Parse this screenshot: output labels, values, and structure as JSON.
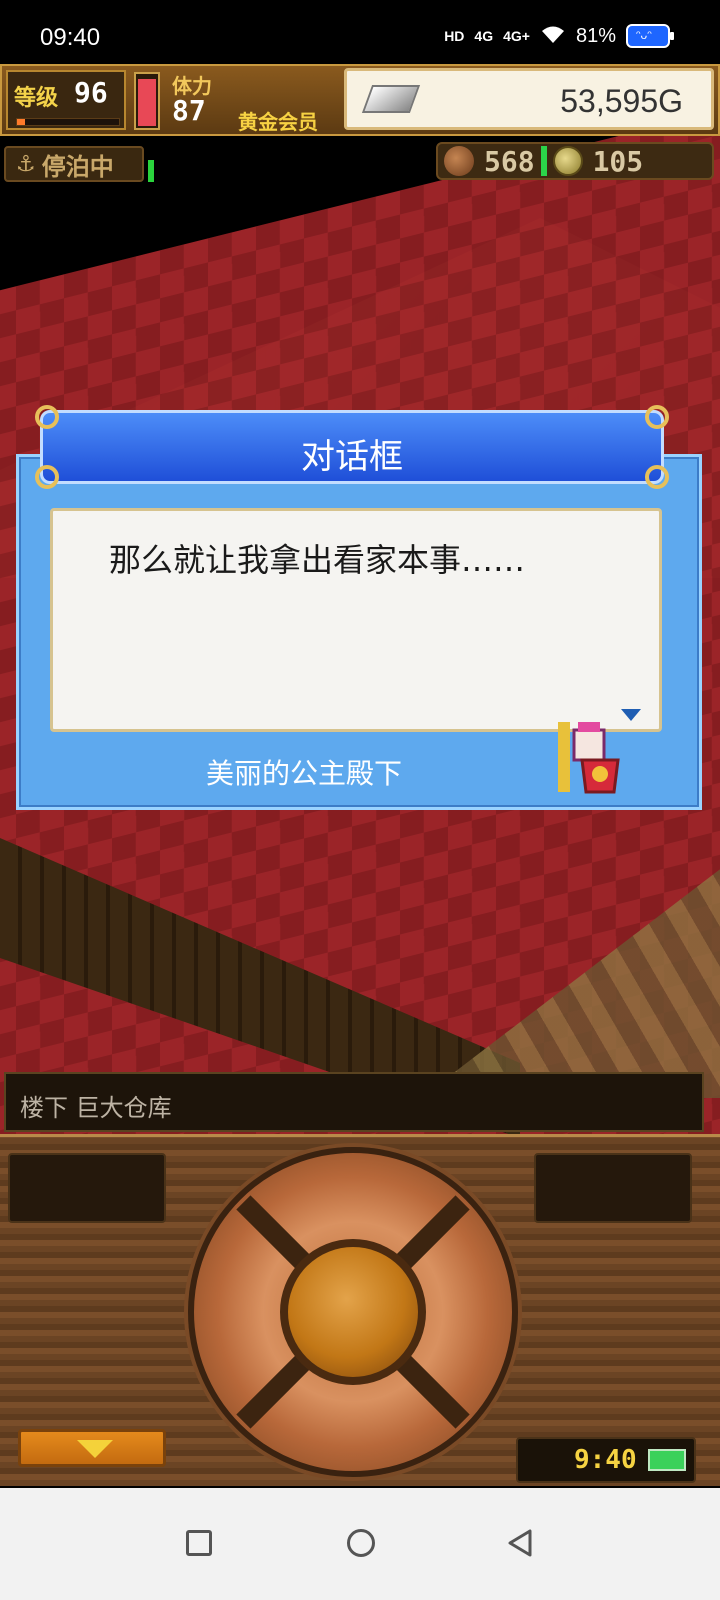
{
  "status_bar": {
    "time": "09:40",
    "hd_label": "HD",
    "network1": "4G",
    "network2": "4G+",
    "battery_percent": "81%"
  },
  "hud": {
    "level_label": "等级",
    "level_value": "96",
    "xp_fraction": 0.08,
    "hp_fraction": 0.95,
    "stamina_label": "体力",
    "stamina_value": "87",
    "member_label": "黄金会员",
    "gold_value": "53,595G",
    "dock_label": "停泊中",
    "resource_meat": "568",
    "resource_coin": "105"
  },
  "dialog": {
    "title": "对话框",
    "message": "那么就让我拿出看家本事……",
    "speaker": "美丽的公主殿下"
  },
  "location": {
    "text": "楼下 巨大仓库"
  },
  "panel": {
    "clock": "9:40"
  },
  "colors": {
    "dialog_header": "#1f4fd8",
    "dialog_frame": "#5ea9ee",
    "gold_text": "#f6d342",
    "floor_red": "#a3262a"
  }
}
